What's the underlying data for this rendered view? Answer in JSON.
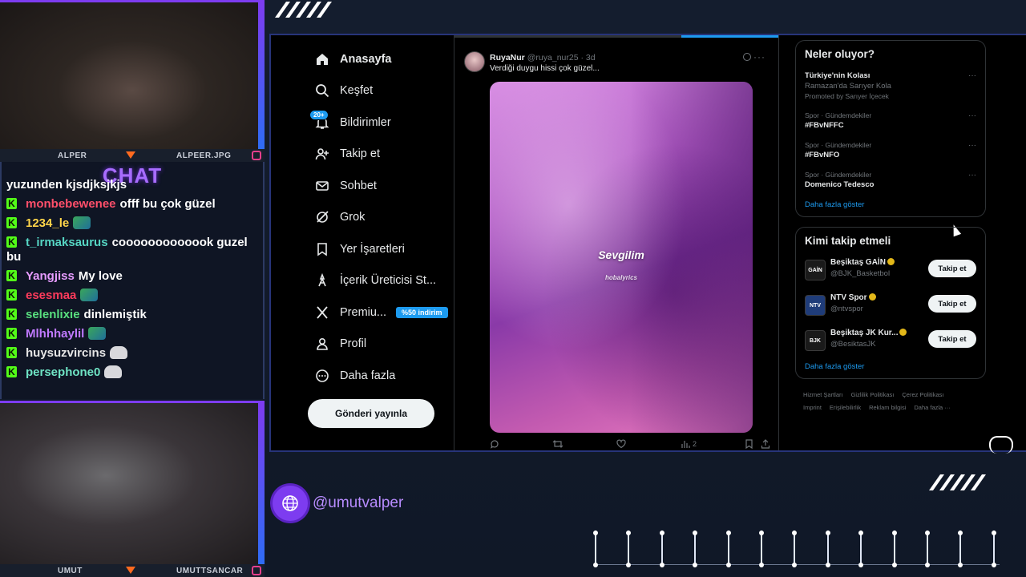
{
  "overlay": {
    "cam_top": {
      "left_name": "ALPER",
      "right_name": "ALPEER.JPG"
    },
    "cam_bottom": {
      "left_name": "UMUT",
      "right_name": "UMUTTSANCAR"
    },
    "chat_title": "CHAT",
    "handle": "@umutvalper",
    "colors": {
      "accent": "#7d3cf0",
      "kick_green": "#53fc18"
    }
  },
  "chat": {
    "cut_line": "yuzunden kjsdjksjkjs",
    "messages": [
      {
        "user": "monbebewenee",
        "color": "#ff4f6a",
        "text": "offf bu çok güzel",
        "emote": ""
      },
      {
        "user": "1234_le",
        "color": "#ffd54a",
        "text": "",
        "emote": "leaf"
      },
      {
        "user": "t_irmaksaurus",
        "color": "#56d6c4",
        "text": "cooooooooooook guzel",
        "emote": ""
      },
      {
        "user": "bu",
        "color": "#ffffff",
        "text": "",
        "emote": "",
        "continuation": true
      },
      {
        "user": "Yangjiss",
        "color": "#e79cff",
        "text": "My love",
        "emote": ""
      },
      {
        "user": "esesmaa",
        "color": "#ff3b5c",
        "text": "",
        "emote": "leaf"
      },
      {
        "user": "selenlixie",
        "color": "#59e07f",
        "text": "dinlemiştik",
        "emote": ""
      },
      {
        "user": "Mlhhhaylil",
        "color": "#c07aff",
        "text": "",
        "emote": "leaf"
      },
      {
        "user": "huysuzvircins",
        "color": "#e6e6e6",
        "text": "",
        "emote": "cat"
      },
      {
        "user": "persephone0",
        "color": "#6fe3c4",
        "text": "",
        "emote": "cat"
      }
    ]
  },
  "x": {
    "nav": [
      {
        "label": "Anasayfa",
        "icon": "home-icon",
        "active": true
      },
      {
        "label": "Keşfet",
        "icon": "search-icon"
      },
      {
        "label": "Bildirimler",
        "icon": "bell-icon",
        "badge": "20+"
      },
      {
        "label": "Takip et",
        "icon": "follow-icon"
      },
      {
        "label": "Sohbet",
        "icon": "mail-icon"
      },
      {
        "label": "Grok",
        "icon": "grok-icon"
      },
      {
        "label": "Yer İşaretleri",
        "icon": "bookmark-icon"
      },
      {
        "label": "İçerik Üreticisi St...",
        "icon": "creator-studio-icon"
      },
      {
        "label": "Premiu...",
        "icon": "x-logo-icon",
        "badge": "%50 indirim"
      },
      {
        "label": "Profil",
        "icon": "profile-icon"
      },
      {
        "label": "Daha fazla",
        "icon": "more-circle-icon"
      }
    ],
    "post_button": "Gönderi yayınla",
    "tweet": {
      "name": "RuyaNur",
      "handle": "@ruya_nur25 · 3d",
      "text": "Verdiği duygu hissi çok güzel...",
      "caption_main": "Sevgilim",
      "caption_sub": "hobalyrics",
      "views": "2"
    },
    "trends": {
      "title": "Neler oluyor?",
      "items": [
        {
          "meta": "",
          "title": "Türkiye'nin Kolası",
          "sub1": "Ramazan'da Sarıyer Kola",
          "sub2": "Promoted by Sarıyer İçecek"
        },
        {
          "meta": "Spor · Gündemdekiler",
          "title": "#FBvNFFC"
        },
        {
          "meta": "Spor · Gündemdekiler",
          "title": "#FBvNFO"
        },
        {
          "meta": "Spor · Gündemdekiler",
          "title": "Domenico Tedesco"
        }
      ],
      "show_more": "Daha fazla göster"
    },
    "who_to_follow": {
      "title": "Kimi takip etmeli",
      "items": [
        {
          "name": "Beşiktaş GAİN",
          "handle": "@BJK_Basketbol",
          "avatar": "GAİN",
          "button": "Takip et"
        },
        {
          "name": "NTV Spor",
          "handle": "@ntvspor",
          "avatar": "NTV",
          "button": "Takip et"
        },
        {
          "name": "Beşiktaş JK Kur...",
          "handle": "@BesiktasJK",
          "avatar": "BJK",
          "button": "Takip et"
        }
      ],
      "show_more": "Daha fazla göster"
    },
    "footer": {
      "row1": [
        "Hizmet Şartları",
        "Gizlilik Politikası",
        "Çerez Politikası"
      ],
      "row2": [
        "Imprint",
        "Erişilebilirlik",
        "Reklam bilgisi",
        "Daha fazla ···"
      ]
    }
  }
}
